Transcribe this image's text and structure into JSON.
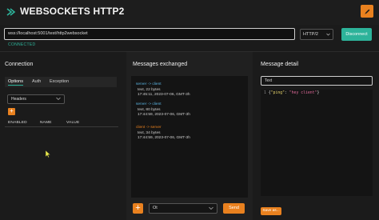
{
  "header": {
    "title": "WEBSOCKETS HTTP2",
    "logo_icon": "app-logo-icon",
    "edit_icon": "pencil-icon",
    "accent": "#e9811f"
  },
  "connection_bar": {
    "url": "wss://localhost:5001/test/http2websocket",
    "protocol": "HTTP/2",
    "disconnect_label": "Disconnect",
    "status": "CONNECTED",
    "status_color": "#2db39a"
  },
  "connection_panel": {
    "title": "Connection",
    "tabs": [
      {
        "label": "Options",
        "active": true
      },
      {
        "label": "Auth",
        "active": false
      },
      {
        "label": "Exception",
        "active": false
      }
    ],
    "headers_select": "Headers",
    "add_label": "+",
    "columns": [
      "ENABLED",
      "NAME",
      "VALUE"
    ]
  },
  "messages_panel": {
    "title": "Messages exchanged",
    "messages": [
      {
        "direction": "server -> client",
        "meta1": "text, 22 bytes",
        "meta2": "17:45:11, 2023-07-06, GMT-3h"
      },
      {
        "direction": "server -> client",
        "meta1": "text, 80 bytes",
        "meta2": "17:44:59, 2023-07-06, GMT-3h"
      },
      {
        "direction": "client -> server",
        "meta1": "text, 34 bytes",
        "meta2": "17:44:59, 2023-07-06, GMT-3h"
      }
    ],
    "add_label": "+",
    "message_type": "Ot",
    "send_label": "Send"
  },
  "detail_panel": {
    "title": "Message detail",
    "format": "Text",
    "line_number": "1",
    "code_open": "{",
    "code_key": "\"ping\"",
    "code_colon": ": ",
    "code_value": "\"hey client\"",
    "code_close": "}",
    "save_label": "Save as..."
  }
}
